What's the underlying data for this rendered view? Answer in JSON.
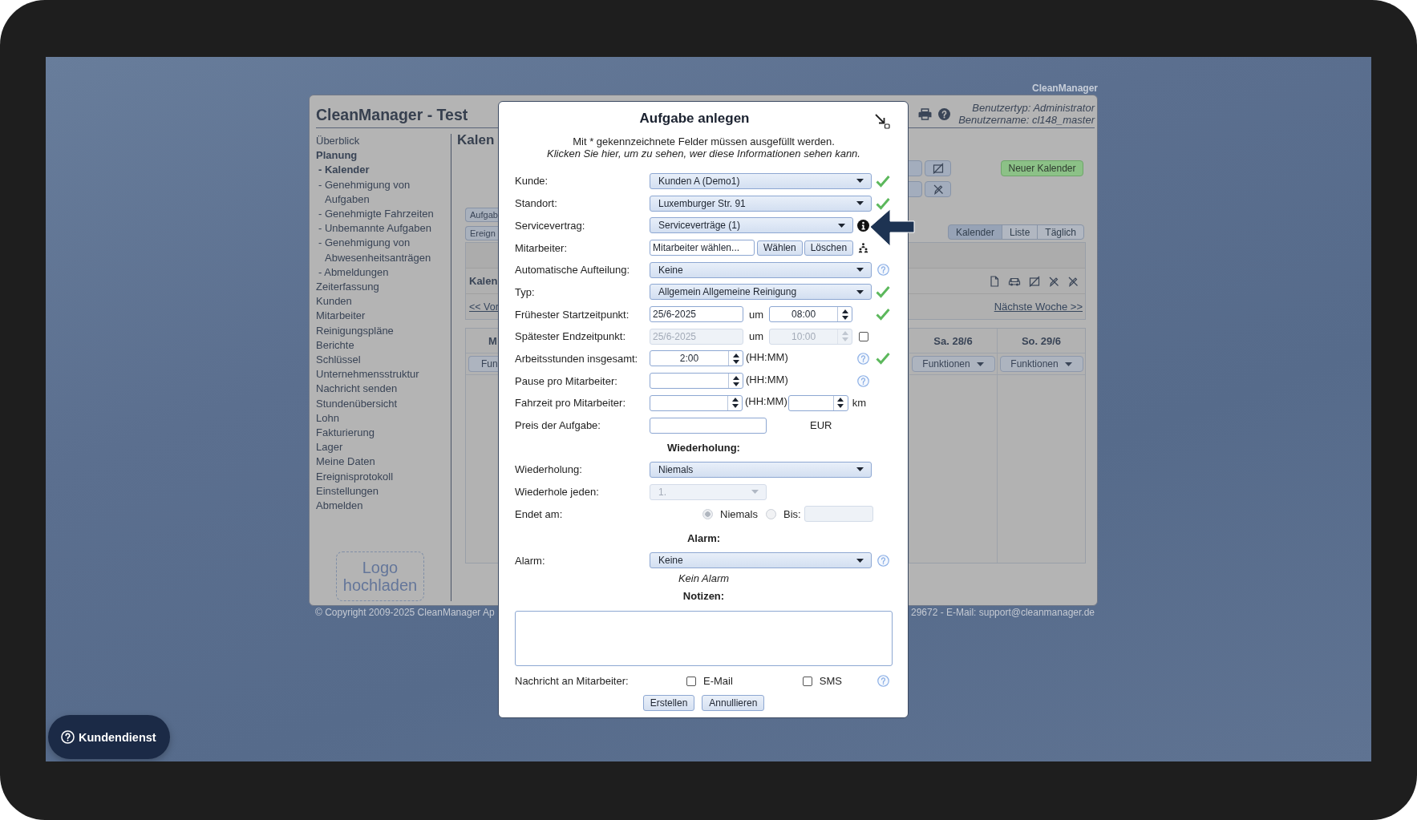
{
  "corner_label": "CleanManager",
  "app": {
    "title": "CleanManager - Test",
    "user_info": [
      "Benutzertyp: Administrator",
      "Benutzername: cl148_master"
    ],
    "sidebar": {
      "items": [
        {
          "label": "Überblick",
          "selected": false
        },
        {
          "label": "Planung",
          "selected": true,
          "children": [
            {
              "label": "- Kalender",
              "selected": true
            },
            {
              "label": "- Genehmigung von Aufgaben",
              "selected": false
            },
            {
              "label": "- Genehmigte Fahrzeiten",
              "selected": false
            },
            {
              "label": "- Unbemannte Aufgaben",
              "selected": false
            },
            {
              "label": "- Genehmigung von Abwesenheitsanträgen",
              "selected": false
            },
            {
              "label": "- Abmeldungen",
              "selected": false
            }
          ]
        },
        {
          "label": "Zeiterfassung",
          "selected": false
        },
        {
          "label": "Kunden",
          "selected": false
        },
        {
          "label": "Mitarbeiter",
          "selected": false
        },
        {
          "label": "Reinigungspläne",
          "selected": false
        },
        {
          "label": "Berichte",
          "selected": false
        },
        {
          "label": "Schlüssel",
          "selected": false
        },
        {
          "label": "Unternehmensstruktur",
          "selected": false
        },
        {
          "label": "Nachricht senden",
          "selected": false
        },
        {
          "label": "Stundenübersicht",
          "selected": false
        },
        {
          "label": "Lohn",
          "selected": false
        },
        {
          "label": "Fakturierung",
          "selected": false
        },
        {
          "label": "Lager",
          "selected": false
        },
        {
          "label": "Meine Daten",
          "selected": false
        },
        {
          "label": "Ereignisprotokoll",
          "selected": false
        },
        {
          "label": "Einstellungen",
          "selected": false
        },
        {
          "label": "Abmelden",
          "selected": false
        }
      ],
      "logo_upload": "Logo hochladen"
    },
    "content": {
      "heading": "Kalen",
      "task_buttons": [
        "Aufgab",
        "Ereign"
      ],
      "new_calendar_button": "Neuer Kalender",
      "view_tabs": [
        {
          "label": "Kalender",
          "selected": true
        },
        {
          "label": "Liste",
          "selected": false
        },
        {
          "label": "Täglich",
          "selected": false
        }
      ],
      "week_panel": {
        "title": "Kalen",
        "prev_link": "<< Vor",
        "next_link": "Nächste Woche >>"
      },
      "calendar": {
        "columns": [
          {
            "day": "M",
            "button": "Fun"
          },
          {
            "day": "Sa. 28/6",
            "button": "Funktionen"
          },
          {
            "day": "So. 29/6",
            "button": "Funktionen"
          }
        ]
      }
    },
    "footer": {
      "copyright": "© Copyright 2009-2025 CleanManager Ap",
      "contact": "29672 - E-Mail: support@cleanmanager.de"
    }
  },
  "dialog": {
    "title": "Aufgabe anlegen",
    "intro": "Mit * gekennzeichnete Felder müssen ausgefüllt werden.",
    "visibility_link": "Klicken Sie hier, um zu sehen, wer diese Informationen sehen kann.",
    "fields": [
      {
        "kind": "select",
        "label": "Kunde:",
        "value": "Kunden A (Demo1)",
        "disabled": false,
        "valid": true
      },
      {
        "kind": "select",
        "label": "Standort:",
        "value": "Luxemburger Str. 91",
        "disabled": false,
        "valid": true
      },
      {
        "kind": "select",
        "label": "Servicevertrag:",
        "value": "Serviceverträge (1)",
        "info": true,
        "disabled": false,
        "valid": false
      },
      {
        "kind": "picker",
        "label": "Mitarbeiter:",
        "value": "Mitarbeiter wählen...",
        "buttons": [
          "Wählen",
          "Löschen"
        ],
        "people": true,
        "disabled": false,
        "valid": false
      },
      {
        "kind": "select",
        "label": "Automatische Aufteilung:",
        "value": "Keine",
        "help": true,
        "disabled": false,
        "valid": false
      },
      {
        "kind": "select",
        "label": "Typ:",
        "value": "Allgemein Allgemeine Reinigung",
        "disabled": false,
        "valid": true
      },
      {
        "kind": "datetime",
        "label": "Frühester Startzeitpunkt:",
        "date": "25/6-2025",
        "joiner": "um",
        "time": "08:00",
        "disabled": false,
        "valid": true
      },
      {
        "kind": "datetime",
        "label": "Spätester Endzeitpunkt:",
        "date": "25/6-2025",
        "joiner": "um",
        "time": "10:00",
        "checked": false,
        "disabled": true,
        "valid": false
      },
      {
        "kind": "duration",
        "label": "Arbeitsstunden insgesamt:",
        "value": "2:00",
        "unit": "(HH:MM)",
        "help": true,
        "disabled": false,
        "valid": true
      },
      {
        "kind": "duration",
        "label": "Pause pro Mitarbeiter:",
        "unit": "(HH:MM)",
        "help": true,
        "disabled": false,
        "valid": false
      },
      {
        "kind": "travel",
        "label": "Fahrzeit pro Mitarbeiter:",
        "unit": "(HH:MM)",
        "distance_unit": "km",
        "disabled": false,
        "valid": false
      },
      {
        "kind": "price",
        "label": "Preis der Aufgabe:",
        "currency": "EUR",
        "disabled": false,
        "valid": false
      }
    ],
    "recurrence": {
      "heading": "Wiederholung:",
      "fields": [
        {
          "kind": "select",
          "label": "Wiederholung:",
          "value": "Niemals",
          "disabled": false,
          "valid": false
        },
        {
          "kind": "short_select",
          "label": "Wiederhole jeden:",
          "value": "1.",
          "disabled": true,
          "valid": false
        },
        {
          "kind": "end",
          "label": "Endet am:",
          "options": [
            {
              "label": "Niemals",
              "selected": true
            },
            {
              "label": "Bis:",
              "selected": false
            }
          ],
          "disabled": true,
          "valid": false
        }
      ]
    },
    "alarm": {
      "heading": "Alarm:",
      "fields": [
        {
          "kind": "select",
          "label": "Alarm:",
          "value": "Keine",
          "help": true,
          "disabled": false,
          "valid": false
        }
      ],
      "note": "Kein Alarm"
    },
    "notes": {
      "heading": "Notizen:"
    },
    "notify": {
      "label": "Nachricht an Mitarbeiter:",
      "channels": [
        {
          "label": "E-Mail",
          "checked": false
        },
        {
          "label": "SMS",
          "checked": false
        }
      ],
      "help": true
    },
    "buttons": [
      "Erstellen",
      "Annullieren"
    ]
  },
  "support_button": "Kundendienst"
}
